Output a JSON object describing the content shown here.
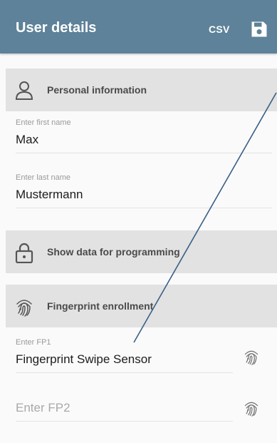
{
  "appbar": {
    "title": "User details",
    "csv_label": "CSV",
    "save_icon": "save-icon",
    "background": "#5d8299"
  },
  "sections": {
    "personal": {
      "label": "Personal information",
      "icon": "person-icon"
    },
    "programming": {
      "label": "Show data for programming",
      "icon": "lock-icon"
    },
    "fingerprint": {
      "label": "Fingerprint enrollment",
      "icon": "fingerprint-icon"
    }
  },
  "fields": {
    "first_name": {
      "hint": "Enter first name",
      "value": "Max"
    },
    "last_name": {
      "hint": "Enter last name",
      "value": "Mustermann"
    },
    "fp1": {
      "hint": "Enter FP1",
      "value": "Fingerprint Swipe Sensor"
    },
    "fp2": {
      "placeholder": "Enter FP2",
      "value": ""
    }
  },
  "colors": {
    "header_bg": "#e2e2e2",
    "annotation_line": "#3a5f86"
  }
}
